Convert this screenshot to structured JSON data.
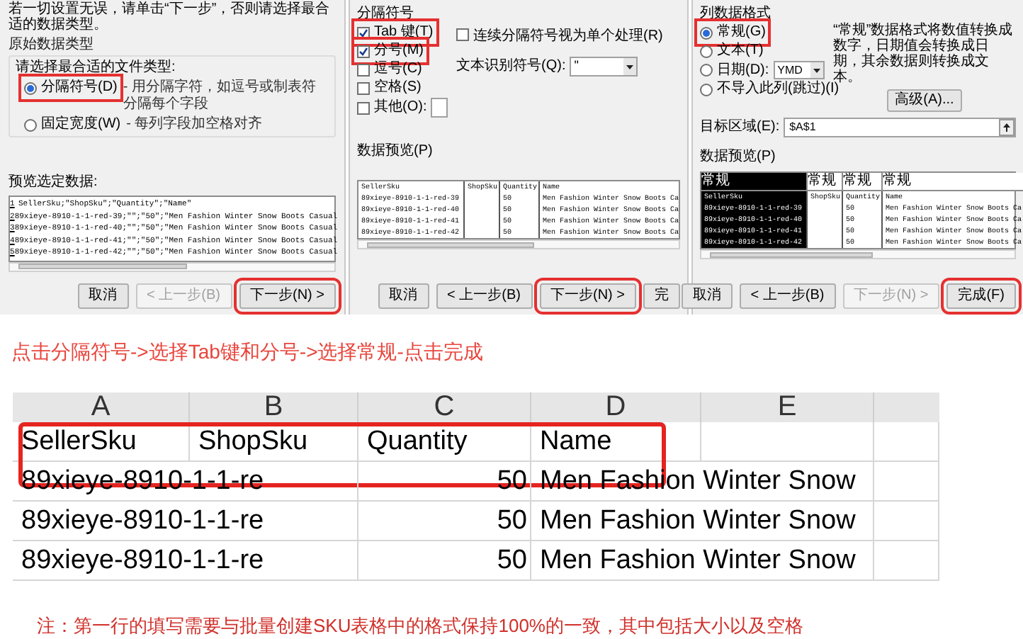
{
  "step1_dialog": {
    "instruction": "若一切设置无误，请单击“下一步”，否则请选择最合适的数据类型。",
    "group_title": "原始数据类型",
    "prompt": "请选择最合适的文件类型:",
    "options": [
      {
        "label": "分隔符号(D)",
        "description": "- 用分隔字符，如逗号或制表符分隔每个字段",
        "selected": true,
        "highlighted": true
      },
      {
        "label": "固定宽度(W)",
        "description": "- 每列字段加空格对齐",
        "selected": false
      }
    ],
    "preview_label": "预览选定数据:",
    "preview_lines": [
      {
        "number": "1",
        "text": "SellerSku;\"ShopSku\";\"Quantity\";\"Name\""
      },
      {
        "number": "2",
        "text": "89xieye-8910-1-1-red-39;\"\";\"50\";\"Men Fashion Winter Snow Boots Casual"
      },
      {
        "number": "3",
        "text": "89xieye-8910-1-1-red-40;\"\";\"50\";\"Men Fashion Winter Snow Boots Casual"
      },
      {
        "number": "4",
        "text": "89xieye-8910-1-1-red-41;\"\";\"50\";\"Men Fashion Winter Snow Boots Casual"
      },
      {
        "number": "5",
        "text": "89xieye-8910-1-1-red-42;\"\";\"50\";\"Men Fashion Winter Snow Boots Casual"
      }
    ],
    "buttons": [
      {
        "label": "取消",
        "disabled": false
      },
      {
        "label": "< 上一步(B)",
        "disabled": true
      },
      {
        "label": "下一步(N) >",
        "disabled": false,
        "highlighted": true
      }
    ]
  },
  "step2_dialog": {
    "group_title": "分隔符号",
    "delimiters": [
      {
        "label": "Tab 键(T)",
        "checked": true,
        "highlighted": true
      },
      {
        "label": "分号(M)",
        "checked": true,
        "highlighted": true
      },
      {
        "label": "逗号(C)",
        "checked": false
      },
      {
        "label": "空格(S)",
        "checked": false
      },
      {
        "label": "其他(O):",
        "checked": false,
        "kind": "other"
      }
    ],
    "consecutive": {
      "label": "连续分隔符号视为单个处理(R)",
      "checked": false
    },
    "qualifier": {
      "label": "文本识别符号(Q):",
      "value": "\""
    },
    "preview_label": "数据预览(P)",
    "preview_rows": [
      [
        "SellerSku",
        "ShopSku",
        "Quantity",
        "Name"
      ],
      [
        "89xieye-8910-1-1-red-39",
        "",
        "50",
        "Men Fashion Winter Snow Boots Ca"
      ],
      [
        "89xieye-8910-1-1-red-40",
        "",
        "50",
        "Men Fashion Winter Snow Boots Ca"
      ],
      [
        "89xieye-8910-1-1-red-41",
        "",
        "50",
        "Men Fashion Winter Snow Boots Ca"
      ],
      [
        "89xieye-8910-1-1-red-42",
        "",
        "50",
        "Men Fashion Winter Snow Boots Ca"
      ]
    ],
    "buttons": [
      {
        "label": "取消",
        "disabled": false
      },
      {
        "label": "< 上一步(B)",
        "disabled": false
      },
      {
        "label": "下一步(N) >",
        "disabled": false,
        "highlighted": true
      },
      {
        "label": "完",
        "disabled": false
      }
    ]
  },
  "step3_dialog": {
    "group_title": "列数据格式",
    "formats": [
      {
        "label": "常规(G)",
        "selected": true,
        "highlighted": true
      },
      {
        "label": "文本(T)",
        "selected": false
      },
      {
        "label": "日期(D):",
        "selected": false,
        "date_format": "YMD"
      },
      {
        "label": "不导入此列(跳过)(I)",
        "selected": false
      }
    ],
    "format_note": "“常规”数据格式将数值转换成数字，日期值会转换成日期，其余数据则转换成文本。",
    "advanced_button": "高级(A)...",
    "destination": {
      "label": "目标区域(E):",
      "value": "$A$1"
    },
    "preview_label": "数据预览(P)",
    "preview_columns": [
      {
        "header": "常规",
        "selected": true
      },
      {
        "header": "常规",
        "selected": false
      },
      {
        "header": "常规",
        "selected": false
      },
      {
        "header": "常规",
        "selected": false
      }
    ],
    "preview_rows": [
      [
        "SellerSku",
        "ShopSku",
        "Quantity",
        "Name"
      ],
      [
        "89xieye-8910-1-1-red-39",
        "",
        "50",
        "Men Fashion Winter Snow Boots Ca"
      ],
      [
        "89xieye-8910-1-1-red-40",
        "",
        "50",
        "Men Fashion Winter Snow Boots Ca"
      ],
      [
        "89xieye-8910-1-1-red-41",
        "",
        "50",
        "Men Fashion Winter Snow Boots Ca"
      ],
      [
        "89xieye-8910-1-1-red-42",
        "",
        "50",
        "Men Fashion Winter Snow Boots Ca"
      ]
    ],
    "buttons": [
      {
        "label": "取消",
        "disabled": false
      },
      {
        "label": "< 上一步(B)",
        "disabled": false
      },
      {
        "label": "下一步(N) >",
        "disabled": true
      },
      {
        "label": "完成(F)",
        "disabled": false,
        "highlighted": true
      }
    ]
  },
  "caption": "点击分隔符号->选择Tab键和分号->选择常规-点击完成",
  "sheet": {
    "columns": [
      "A",
      "B",
      "C",
      "D",
      "E"
    ],
    "rows": [
      {
        "highlighted": true,
        "cells": [
          {
            "text": "SellerSku",
            "kind": "text"
          },
          {
            "text": "ShopSku",
            "kind": "text"
          },
          {
            "text": "Quantity",
            "kind": "text"
          },
          {
            "text": "Name",
            "kind": "text"
          }
        ]
      },
      {
        "cells": [
          {
            "text": "89xieye-8910-1-1-re",
            "kind": "text",
            "overflows": true
          },
          {
            "text": "50",
            "kind": "number"
          },
          {
            "text": "Men Fashion Winter Snow",
            "kind": "text",
            "overflows": true
          }
        ]
      },
      {
        "cells": [
          {
            "text": "89xieye-8910-1-1-re",
            "kind": "text",
            "overflows": true
          },
          {
            "text": "50",
            "kind": "number"
          },
          {
            "text": "Men Fashion Winter Snow",
            "kind": "text",
            "overflows": true
          }
        ]
      },
      {
        "cells": [
          {
            "text": "89xieye-8910-1-1-re",
            "kind": "text",
            "overflows": true
          },
          {
            "text": "50",
            "kind": "number"
          },
          {
            "text": "Men Fashion Winter Snow",
            "kind": "text",
            "overflows": true
          }
        ]
      }
    ]
  },
  "note": "注：第一行的填写需要与批量创建SKU表格中的格式保持100%的一致，其中包括大小以及空格"
}
